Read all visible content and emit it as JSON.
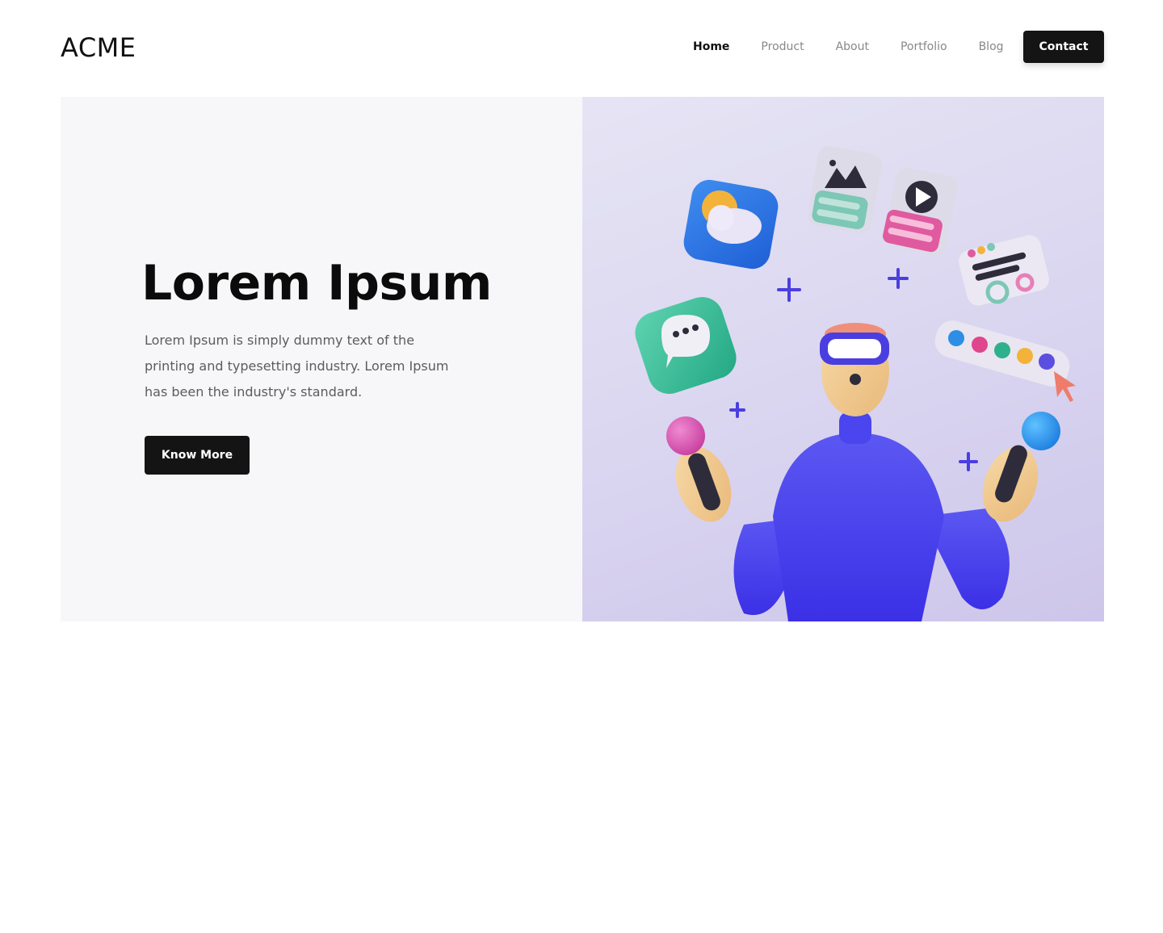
{
  "header": {
    "logo": "ACME",
    "nav": [
      {
        "label": "Home",
        "active": true
      },
      {
        "label": "Product",
        "active": false
      },
      {
        "label": "About",
        "active": false
      },
      {
        "label": "Portfolio",
        "active": false
      },
      {
        "label": "Blog",
        "active": false
      }
    ],
    "contact_label": "Contact"
  },
  "hero": {
    "title": "Lorem Ipsum",
    "description": "Lorem Ipsum is simply dummy text of the printing and typesetting industry. Lorem Ipsum has been the industry's standard.",
    "cta_label": "Know More"
  },
  "colors": {
    "button_bg": "#141414",
    "hero_left_bg": "#f7f7f9",
    "hero_right_bg": "#dcd8f1",
    "accent_purple": "#4b3ee0"
  },
  "illustration": {
    "icons": [
      "weather-app-icon",
      "image-card-icon",
      "video-card-icon",
      "settings-card-icon",
      "chat-bubble-icon",
      "color-palette-icon",
      "cursor-icon",
      "plus-icon",
      "vr-headset-icon"
    ]
  }
}
